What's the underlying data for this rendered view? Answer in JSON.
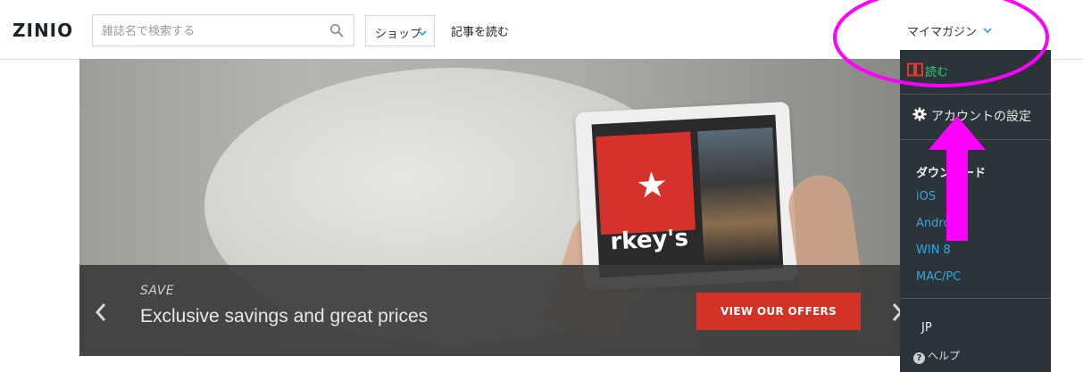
{
  "header": {
    "logo": "ZINIO",
    "search_placeholder": "雑誌名で検索する",
    "shop_label": "ショップ",
    "read_articles": "記事を読む",
    "my_magazine": "マイマガジン"
  },
  "hero": {
    "tag": "SAVE",
    "headline": "Exclusive savings and great prices",
    "cta": "VIEW OUR OFFERS",
    "tablet_text": "rkey's"
  },
  "dropdown": {
    "read": "読む",
    "account_settings": "アカウントの設定",
    "downloads_title": "ダウンロード",
    "downloads": [
      "iOS",
      "Android",
      "WIN 8",
      "MAC/PC"
    ],
    "region": "JP",
    "help": "ヘルプ"
  },
  "colors": {
    "accent_red": "#d23327",
    "menu_bg": "#2a3439",
    "link_blue": "#35a7e0",
    "read_green": "#2ecc71",
    "annotation_magenta": "#ff00ff"
  },
  "icons": {
    "search": "magnifier-icon",
    "chevron": "chevron-down-icon",
    "book": "book-open-icon",
    "gear": "gear-icon",
    "help": "question-circle-icon"
  }
}
